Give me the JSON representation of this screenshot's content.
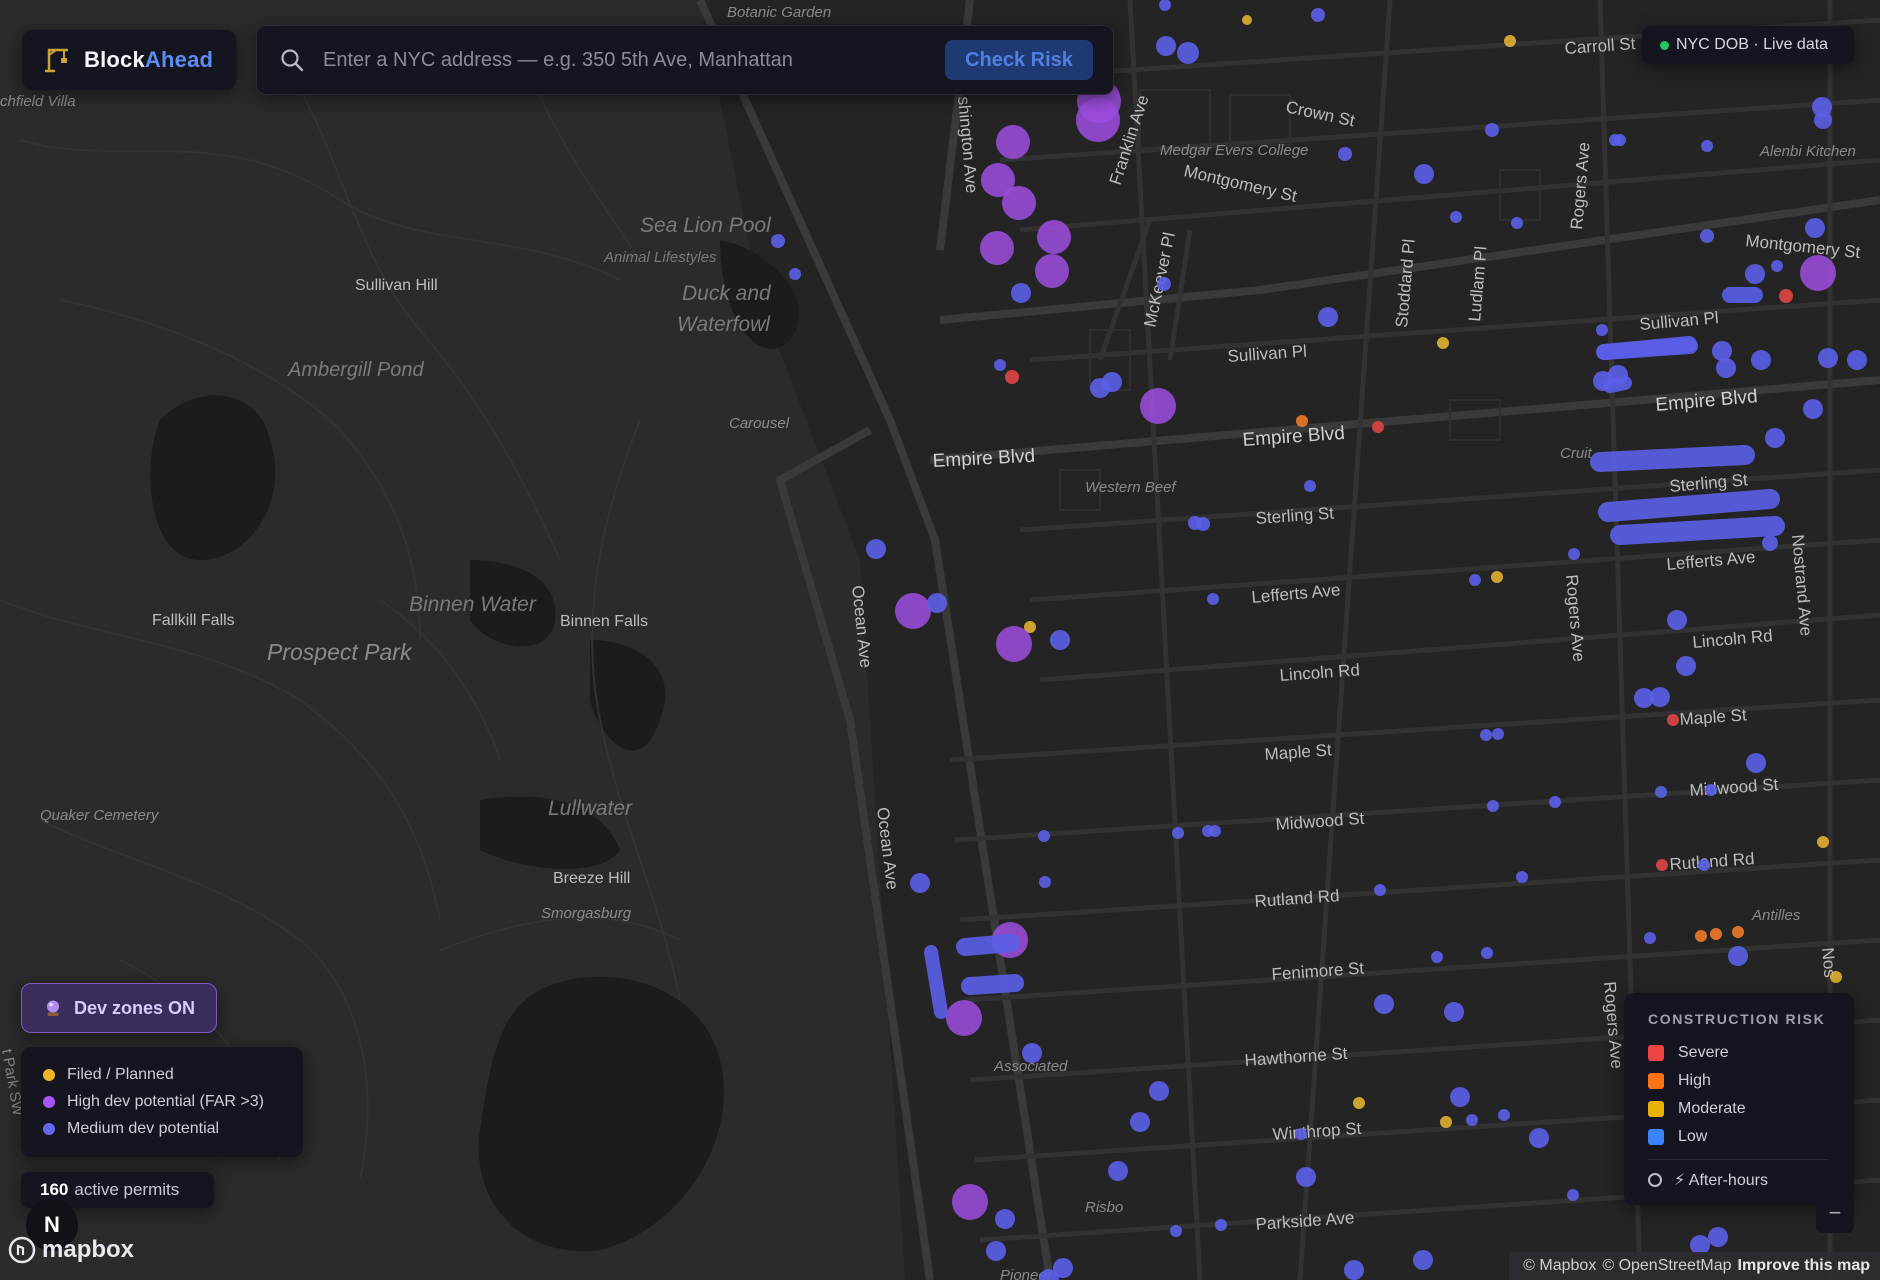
{
  "brand": {
    "name_part1": "Block",
    "name_part2": "Ahead"
  },
  "search": {
    "placeholder": "Enter a NYC address — e.g. 350 5th Ave, Manhattan",
    "value": "",
    "button_label": "Check Risk"
  },
  "live_badge": {
    "label": "NYC DOB · Live data",
    "dot_color": "#22c55e"
  },
  "dev_toggle": {
    "label": "Dev zones ON"
  },
  "dev_legend": [
    {
      "label": "Filed / Planned",
      "color": "#f0b429"
    },
    {
      "label": "High dev potential (FAR >3)",
      "color": "#a855f7"
    },
    {
      "label": "Medium dev potential",
      "color": "#6366f1"
    }
  ],
  "permits": {
    "count": "160",
    "label": "active permits"
  },
  "compass": {
    "label": "N"
  },
  "mapbox_logo": {
    "label": "mapbox"
  },
  "risk_legend": {
    "title": "CONSTRUCTION RISK",
    "levels": [
      {
        "label": "Severe",
        "color": "#ef4444"
      },
      {
        "label": "High",
        "color": "#f97316"
      },
      {
        "label": "Moderate",
        "color": "#eab308"
      },
      {
        "label": "Low",
        "color": "#3b82f6"
      }
    ],
    "after_hours_label": "⚡ After-hours"
  },
  "attribution": {
    "mapbox": "© Mapbox",
    "osm": "© OpenStreetMap",
    "improve": "Improve this map"
  },
  "map_labels": {
    "botanic_garden": "Botanic Garden",
    "carroll_st": "Carroll St",
    "crown_st": "Crown St",
    "medgar_evers": "Medgar Evers College",
    "montgomery_st": "Montgomery St",
    "montgomery_st_e": "Montgomery St",
    "alenbi_kitchen": "Alenbi Kitchen",
    "sullivan_pl": "Sullivan Pl",
    "sullivan_pl_e": "Sullivan Pl",
    "empire_blvd_w": "Empire Blvd",
    "empire_blvd_m": "Empire Blvd",
    "empire_blvd_e": "Empire Blvd",
    "western_beef": "Western Beef",
    "sterling_st": "Sterling St",
    "sterling_st_e": "Sterling St",
    "lefferts_ave": "Lefferts Ave",
    "lefferts_ave_e": "Lefferts Ave",
    "lincoln_rd": "Lincoln Rd",
    "lincoln_rd_e": "Lincoln Rd",
    "maple_st": "Maple St",
    "maple_st_e": "Maple St",
    "midwood_st": "Midwood St",
    "midwood_st_e": "Midwood St",
    "rutland_rd": "Rutland Rd",
    "rutland_rd_e": "Rutland Rd",
    "fenimore_st": "Fenimore St",
    "hawthorne_st": "Hawthorne St",
    "winthrop_st": "Winthrop St",
    "parkside_ave": "Parkside Ave",
    "antilles": "Antilles",
    "associated": "Associated",
    "risbo": "Risbo",
    "pioneer": "Pioneer",
    "cruit": "Cruit",
    "sea_lion_pool": "Sea Lion Pool",
    "animal_lifestyles": "Animal Lifestyles",
    "duck_and": "Duck and",
    "waterfowl": "Waterfowl",
    "sullivan_hill": "Sullivan Hill",
    "ambergill_pond": "Ambergill Pond",
    "carousel": "Carousel",
    "binnen_water": "Binnen Water",
    "binnen_falls": "Binnen Falls",
    "fallkill_falls": "Fallkill Falls",
    "prospect_park": "Prospect Park",
    "lullwater": "Lullwater",
    "quaker_cemetery": "Quaker Cemetery",
    "breeze_hill": "Breeze Hill",
    "smorgasburg": "Smorgasburg",
    "archfield_villa": "chfield Villa",
    "washington_ave": "shington Ave",
    "franklin_ave": "Franklin Ave",
    "mckeever_pl": "McKeever Pl",
    "stoddard_pl": "Stoddard Pl",
    "ludlam_pl": "Ludlam Pl",
    "rogers_ave_n": "Rogers Ave",
    "rogers_ave_m": "Rogers Ave",
    "rogers_ave_s": "Rogers Ave",
    "nostrand_ave": "Nostrand Ave",
    "nostrand_ave_s": "Nos",
    "ocean_ave_n": "Ocean Ave",
    "ocean_ave_s": "Ocean Ave",
    "park_sw": "t Park SW"
  }
}
